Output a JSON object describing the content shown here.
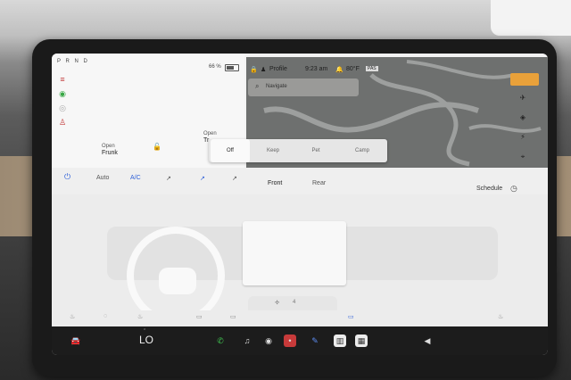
{
  "car": {
    "gear": "P R N D",
    "battery": "66 %",
    "battery_fraction": 0.66,
    "frunk_action": "Open",
    "frunk_label": "Frunk",
    "trunk_action": "Open",
    "trunk_label": "Tr",
    "side_icons": [
      "headlight-icon",
      "parking-light-icon",
      "fog-light-icon",
      "seatbelt-icon"
    ]
  },
  "status": {
    "profile": "Profile",
    "time": "9:23 am",
    "temperature": "80°F",
    "extra": "PAS"
  },
  "navigation": {
    "search_placeholder": "Navigate"
  },
  "climate_mode": {
    "options": [
      "Off",
      "Keep",
      "Pet",
      "Camp"
    ],
    "selected": "Off"
  },
  "climate": {
    "auto": "Auto",
    "ac": "A/C",
    "front": "Front",
    "rear": "Rear",
    "schedule": "Schedule",
    "fan_level": "4"
  },
  "dock": {
    "driver_temp": "LO"
  },
  "colors": {
    "accent_blue": "#2d5fd8",
    "badge_orange": "#e9a13a"
  }
}
